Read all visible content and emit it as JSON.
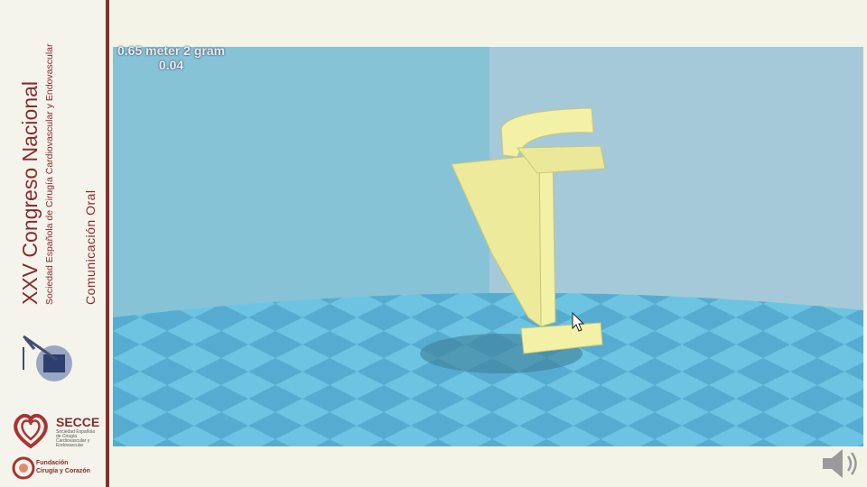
{
  "sidebar": {
    "title": "XXV Congreso Nacional",
    "subtitle": "Sociedad Española de Cirugía Cardiovascular y Endovascular",
    "session": "Comunicación Oral",
    "secce_name": "SECCE",
    "secce_small": "Sociedad Española de Cirugía Cardiovascular y Endovascular",
    "foundation_line1": "Fundación",
    "foundation_line2": "Cirugía y Corazón"
  },
  "viewport": {
    "readout_line1": "0.65 meter 2 gram",
    "readout_line2": "0.04"
  },
  "colors": {
    "accent": "#8a2b2b",
    "sky_left": "#86c3d6",
    "sky_right": "#a5c9d8",
    "floor_light": "#6cc4e2",
    "floor_dark": "#56acd0",
    "model": "#f3f1a6"
  },
  "icons": {
    "speaker": "speaker-icon",
    "cursor": "mouse-pointer-icon"
  }
}
